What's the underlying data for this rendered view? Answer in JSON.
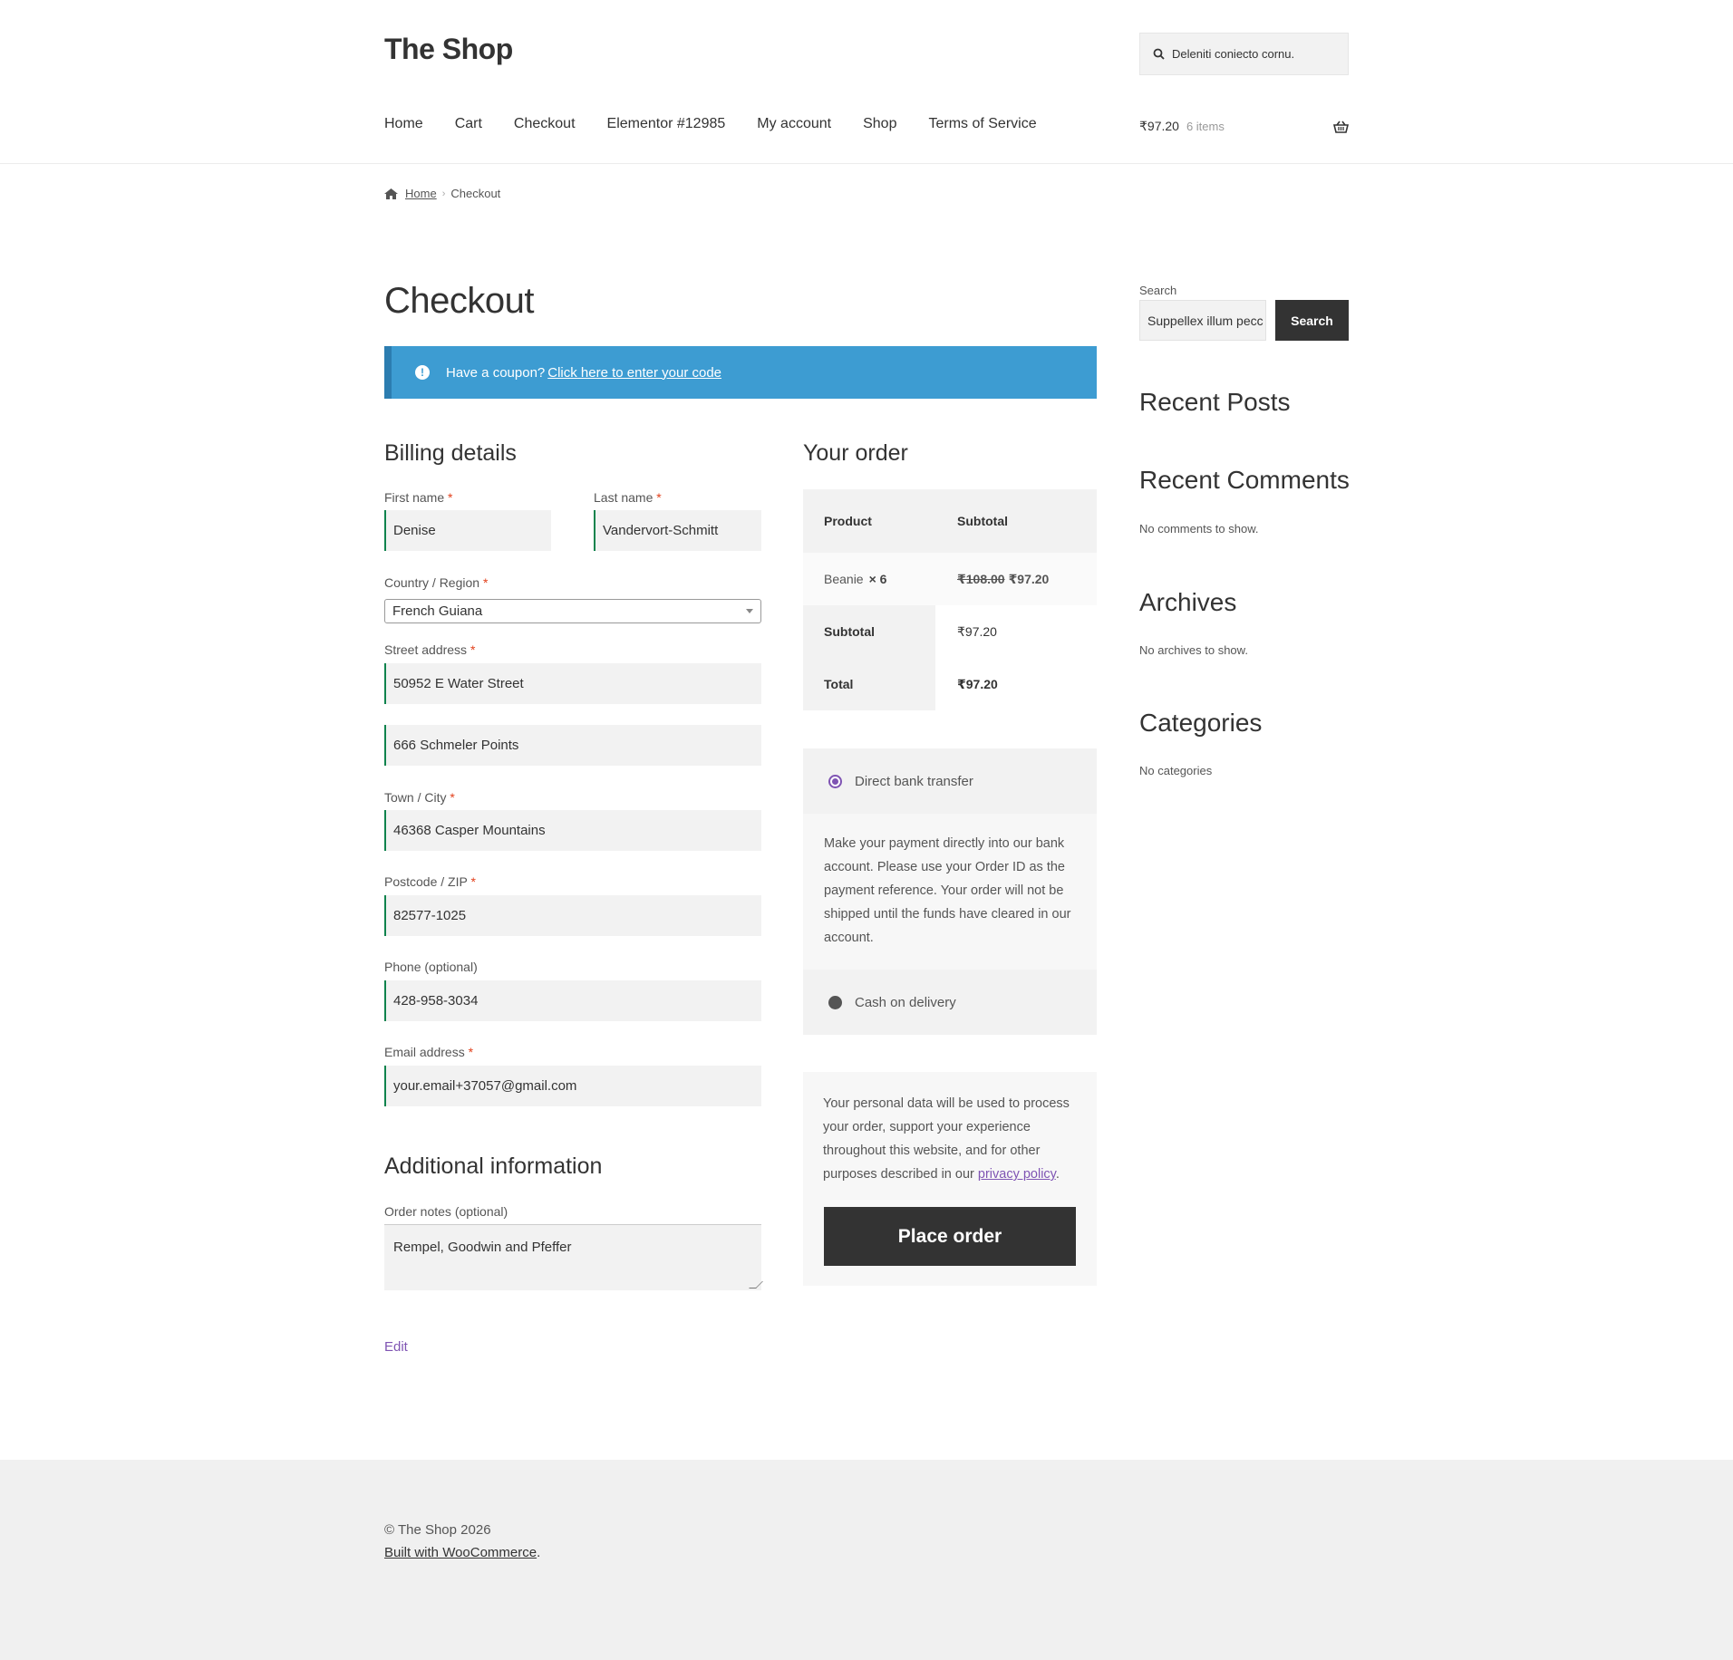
{
  "header": {
    "site_title": "The Shop",
    "search_placeholder": "Deleniti coniecto cornu.",
    "nav": [
      "Home",
      "Cart",
      "Checkout",
      "Elementor #12985",
      "My account",
      "Shop",
      "Terms of Service"
    ],
    "cart_total": "₹97.20",
    "cart_count": "6 items"
  },
  "breadcrumb": {
    "home": "Home",
    "current": "Checkout"
  },
  "page_title": "Checkout",
  "coupon": {
    "text": "Have a coupon?",
    "link": "Click here to enter your code"
  },
  "billing": {
    "title": "Billing details",
    "first_name_label": "First name",
    "first_name": "Denise",
    "last_name_label": "Last name",
    "last_name": "Vandervort-Schmitt",
    "country_label": "Country / Region",
    "country": "French Guiana",
    "street_label": "Street address",
    "street1": "50952 E Water Street",
    "street2": "666 Schmeler Points",
    "city_label": "Town / City",
    "city": "46368 Casper Mountains",
    "postcode_label": "Postcode / ZIP",
    "postcode": "82577-1025",
    "phone_label": "Phone (optional)",
    "phone": "428-958-3034",
    "email_label": "Email address",
    "email": "your.email+37057@gmail.com",
    "required_mark": "*"
  },
  "additional": {
    "title": "Additional information",
    "notes_label": "Order notes (optional)",
    "notes": "Rempel, Goodwin and Pfeffer",
    "edit": "Edit"
  },
  "order": {
    "title": "Your order",
    "col_product": "Product",
    "col_subtotal": "Subtotal",
    "item_name": "Beanie",
    "item_qty": "× 6",
    "item_old_price": "₹108.00",
    "item_price": "₹97.20",
    "subtotal_label": "Subtotal",
    "subtotal": "₹97.20",
    "total_label": "Total",
    "total": "₹97.20"
  },
  "payment": {
    "bank_label": "Direct bank transfer",
    "bank_desc": "Make your payment directly into our bank account. Please use your Order ID as the payment reference. Your order will not be shipped until the funds have cleared in our account.",
    "cod_label": "Cash on delivery"
  },
  "privacy": {
    "text": "Your personal data will be used to process your order, support your experience throughout this website, and for other purposes described in our",
    "link": "privacy policy",
    "end": "."
  },
  "place_order": "Place order",
  "sidebar": {
    "search_label": "Search",
    "search_value": "Suppellex illum pecc",
    "search_button": "Search",
    "recent_posts": "Recent Posts",
    "recent_comments": "Recent Comments",
    "no_comments": "No comments to show.",
    "archives": "Archives",
    "no_archives": "No archives to show.",
    "categories": "Categories",
    "no_categories": "No categories"
  },
  "footer": {
    "copyright": "© The Shop 2026",
    "built_link": "Built with WooCommerce",
    "built_end": "."
  },
  "colors": {
    "accent": "#7f54b3",
    "coupon_bg": "#3d9cd2",
    "field_border": "#0f834d",
    "button_dark": "#333333"
  }
}
